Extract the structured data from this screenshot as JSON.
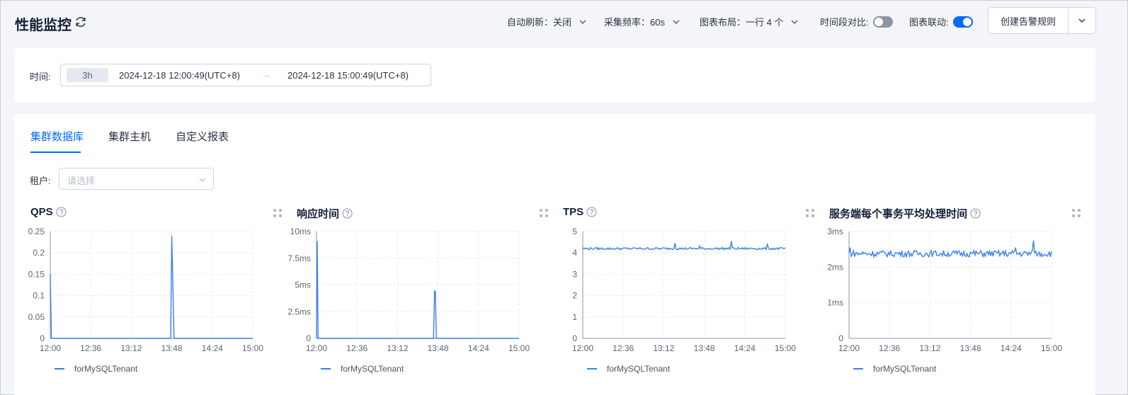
{
  "header": {
    "title": "性能监控",
    "auto_refresh": "自动刷新：关闭",
    "collect_freq": "采集频率：60s",
    "layout": "图表布局：一行 4 个",
    "compare": "时间段对比:",
    "linkage": "图表联动:",
    "create_alert": "创建告警规则",
    "compare_on": false,
    "linkage_on": true
  },
  "time": {
    "label": "时间:",
    "range": "3h",
    "start": "2024-12-18 12:00:49(UTC+8)",
    "arrow": "→",
    "end": "2024-12-18 15:00:49(UTC+8)"
  },
  "tabs": [
    {
      "label": "集群数据库",
      "active": true
    },
    {
      "label": "集群主机",
      "active": false
    },
    {
      "label": "自定义报表",
      "active": false
    }
  ],
  "tenant": {
    "label": "租户:",
    "placeholder": "请选择"
  },
  "colors": {
    "accent": "#006aff",
    "series": "#3a7ff0"
  },
  "chart_data": [
    {
      "type": "line",
      "title": "QPS",
      "x_ticks": [
        "12:00",
        "12:36",
        "13:12",
        "13:48",
        "14:24",
        "15:00"
      ],
      "y_ticks": [
        "0",
        "0.05",
        "0.1",
        "0.15",
        "0.2",
        "0.25"
      ],
      "ylim": [
        0,
        0.25
      ],
      "xlim_minutes": [
        0,
        180
      ],
      "series": [
        {
          "name": "forMySQLTenant",
          "points": [
            [
              0,
              0.15
            ],
            [
              1,
              0
            ],
            [
              107,
              0
            ],
            [
              108,
              0.24
            ],
            [
              109,
              0.12
            ],
            [
              110,
              0
            ],
            [
              180,
              0
            ]
          ]
        }
      ]
    },
    {
      "type": "line",
      "title": "响应时间",
      "x_ticks": [
        "12:00",
        "12:36",
        "13:12",
        "13:48",
        "14:24",
        "15:00"
      ],
      "y_ticks": [
        "0",
        "2.5ms",
        "5ms",
        "7.5ms",
        "10ms"
      ],
      "ylim": [
        0,
        10
      ],
      "xlim_minutes": [
        0,
        180
      ],
      "series": [
        {
          "name": "forMySQLTenant",
          "points": [
            [
              0,
              0
            ],
            [
              0.6,
              9.1
            ],
            [
              1.4,
              0
            ],
            [
              104,
              0
            ],
            [
              105,
              4.5
            ],
            [
              105.7,
              4.3
            ],
            [
              106.5,
              0
            ],
            [
              180,
              0
            ]
          ]
        }
      ]
    },
    {
      "type": "line",
      "title": "TPS",
      "x_ticks": [
        "12:00",
        "12:36",
        "13:12",
        "13:48",
        "14:24",
        "15:00"
      ],
      "y_ticks": [
        "0",
        "1",
        "2",
        "3",
        "4",
        "5"
      ],
      "ylim": [
        0,
        5
      ],
      "xlim_minutes": [
        0,
        180
      ],
      "series": [
        {
          "name": "forMySQLTenant",
          "base": 4.2,
          "noise": 0.05,
          "spikes": [
            [
              82,
              4.45
            ],
            [
              132,
              4.55
            ],
            [
              164,
              4.4
            ],
            [
              104,
              4.32
            ]
          ],
          "points": []
        }
      ]
    },
    {
      "type": "line",
      "title": "服务端每个事务平均处理时间",
      "x_ticks": [
        "12:00",
        "12:36",
        "13:12",
        "13:48",
        "14:24",
        "15:00"
      ],
      "y_ticks": [
        "0",
        "1ms",
        "2ms",
        "3ms"
      ],
      "ylim": [
        0,
        3
      ],
      "xlim_minutes": [
        0,
        180
      ],
      "series": [
        {
          "name": "forMySQLTenant",
          "base": 2.38,
          "noise": 0.09,
          "spikes": [
            [
              1,
              2.55
            ],
            [
              148,
              2.55
            ],
            [
              164,
              2.75
            ]
          ],
          "points": []
        }
      ]
    }
  ]
}
